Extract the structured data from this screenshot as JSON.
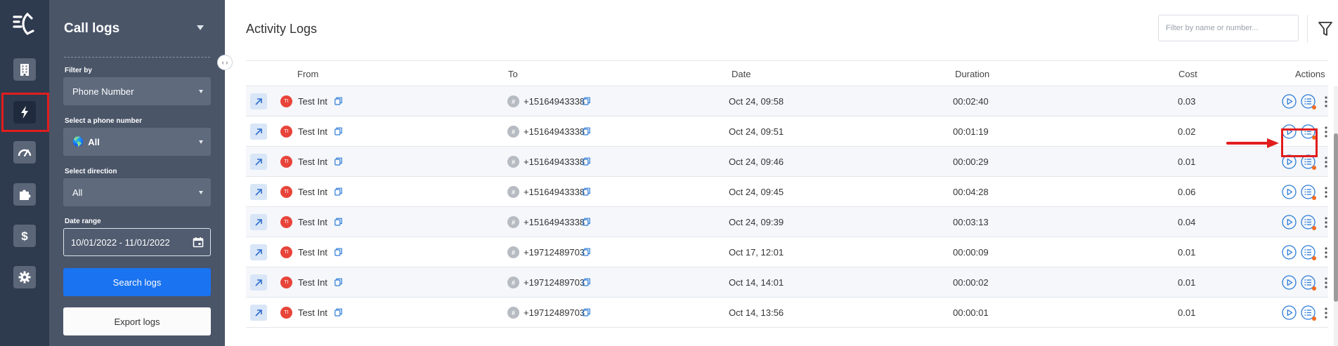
{
  "rail": {
    "items": [
      {
        "icon": "building-icon"
      },
      {
        "icon": "lightning-icon",
        "active": true
      },
      {
        "icon": "speedometer-icon"
      },
      {
        "icon": "puzzle-icon"
      },
      {
        "icon": "dollar-icon"
      },
      {
        "icon": "gear-icon"
      }
    ]
  },
  "panel": {
    "title": "Call logs",
    "filter_by_label": "Filter by",
    "filter_by_value": "Phone Number",
    "phone_label": "Select a phone number",
    "phone_value": "All",
    "direction_label": "Select direction",
    "direction_value": "All",
    "date_label": "Date range",
    "date_value": "10/01/2022 - 11/01/2022",
    "search_button": "Search logs",
    "export_button": "Export logs",
    "collapse_glyph": "‹ ›"
  },
  "main": {
    "title": "Activity Logs",
    "filter_placeholder": "Filter by name or number...",
    "columns": {
      "from": "From",
      "to": "To",
      "date": "Date",
      "duration": "Duration",
      "cost": "Cost",
      "actions": "Actions"
    },
    "rows": [
      {
        "initials": "TI",
        "from": "Test Int",
        "to": "+15164943338",
        "date": "Oct 24, 09:58",
        "duration": "00:02:40",
        "cost": "0.03"
      },
      {
        "initials": "TI",
        "from": "Test Int",
        "to": "+15164943338",
        "date": "Oct 24, 09:51",
        "duration": "00:01:19",
        "cost": "0.02"
      },
      {
        "initials": "TI",
        "from": "Test Int",
        "to": "+15164943338",
        "date": "Oct 24, 09:46",
        "duration": "00:00:29",
        "cost": "0.01"
      },
      {
        "initials": "TI",
        "from": "Test Int",
        "to": "+15164943338",
        "date": "Oct 24, 09:45",
        "duration": "00:04:28",
        "cost": "0.06"
      },
      {
        "initials": "TI",
        "from": "Test Int",
        "to": "+15164943338",
        "date": "Oct 24, 09:39",
        "duration": "00:03:13",
        "cost": "0.04"
      },
      {
        "initials": "TI",
        "from": "Test Int",
        "to": "+19712489703",
        "date": "Oct 17, 12:01",
        "duration": "00:00:09",
        "cost": "0.01"
      },
      {
        "initials": "TI",
        "from": "Test Int",
        "to": "+19712489703",
        "date": "Oct 14, 14:01",
        "duration": "00:00:02",
        "cost": "0.01"
      },
      {
        "initials": "TI",
        "from": "Test Int",
        "to": "+19712489703",
        "date": "Oct 14, 13:56",
        "duration": "00:00:01",
        "cost": "0.01"
      }
    ]
  },
  "colors": {
    "rail_bg": "#2e3a4e",
    "panel_bg": "#4a5568",
    "primary": "#1a73f0",
    "avatar": "#e8443a",
    "highlight": "#e11d1d"
  }
}
